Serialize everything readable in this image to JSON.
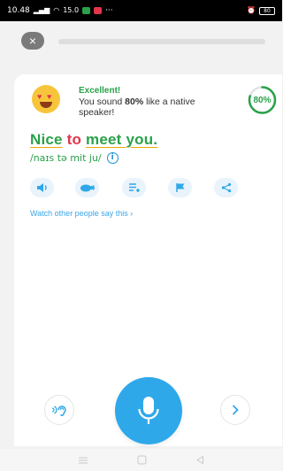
{
  "status_bar": {
    "time": "10.48",
    "signal": "all",
    "network_speed": "15.0",
    "more": "···",
    "battery": "80"
  },
  "top": {
    "close_symbol": "×",
    "progress_fraction": 0.0
  },
  "feedback": {
    "title": "Excellent!",
    "message_pre": "You sound ",
    "message_bold": "80%",
    "message_post": " like a native speaker!",
    "score_label": "80%",
    "score_value": 80
  },
  "phrase": {
    "word1": "Nice",
    "word2": "to",
    "word3": "meet you."
  },
  "ipa": {
    "text": "/naɪs tə mit ju/",
    "info_symbol": "i"
  },
  "actions": [
    {
      "icon": "speaker-icon",
      "name": "play-audio-button"
    },
    {
      "icon": "slow-turtle-icon",
      "name": "play-slow-button"
    },
    {
      "icon": "add-list-icon",
      "name": "add-to-list-button"
    },
    {
      "icon": "flag-icon",
      "name": "report-button"
    },
    {
      "icon": "share-icon",
      "name": "share-button"
    }
  ],
  "watch_link": "Watch other people say this ›",
  "colors": {
    "green": "#2aa14a",
    "blue": "#2fa8ea",
    "red": "#e2354a",
    "underline": "#f0a500"
  }
}
